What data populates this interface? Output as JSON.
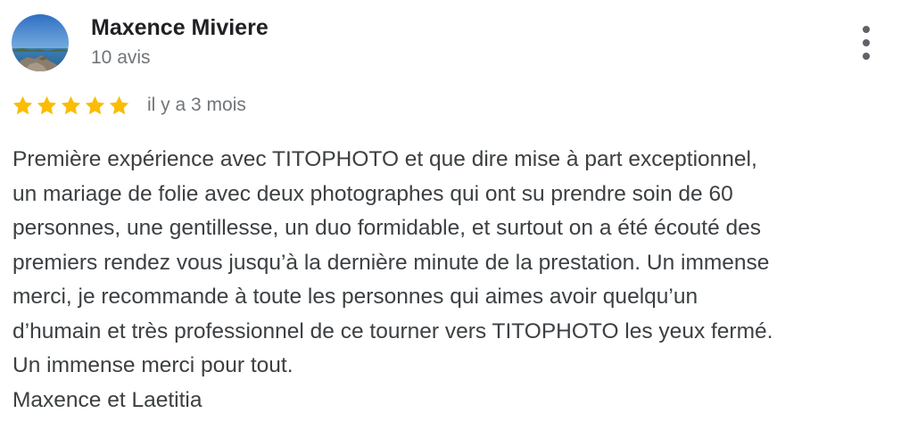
{
  "reviewer": {
    "name": "Maxence Miviere",
    "review_count": "10 avis",
    "avatar_icon": "landscape-photo-avatar"
  },
  "rating": {
    "stars": 5,
    "max_stars": 5,
    "star_color": "#fbbc04",
    "star_icon": "star-icon"
  },
  "date": "il y a 3 mois",
  "menu_icon": "more-vertical-icon",
  "review": {
    "lines": [
      "Première expérience avec TITOPHOTO et que dire mise à part exceptionnel,",
      "un mariage de folie avec deux photographes qui ont su prendre soin de 60",
      "personnes, une gentillesse, un duo formidable, et surtout on a été écouté des",
      "premiers rendez vous jusqu’à la dernière minute de la prestation. Un immense",
      "merci, je recommande à toute les personnes qui aimes avoir quelqu’un",
      "d’humain et très professionnel de ce tourner vers TITOPHOTO les yeux fermé.",
      "Un immense merci pour tout.",
      "Maxence et Laetitia"
    ]
  },
  "colors": {
    "primary_text": "#202124",
    "secondary_text": "#70757a",
    "body_text": "#3c4043"
  }
}
